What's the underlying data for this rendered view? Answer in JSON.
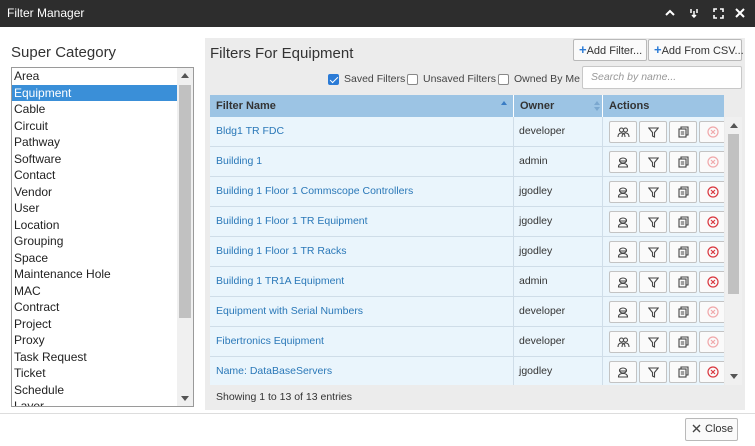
{
  "window": {
    "title": "Filter Manager",
    "controls": [
      "chevron-up-icon",
      "minimize-icon",
      "maximize-icon",
      "close-icon"
    ]
  },
  "super_category": {
    "title": "Super Category",
    "selected": "Equipment",
    "items": [
      "Area",
      "Equipment",
      "Cable",
      "Circuit",
      "Pathway",
      "Software",
      "Contact",
      "Vendor",
      "User",
      "Location",
      "Grouping",
      "Space",
      "Maintenance Hole",
      "MAC",
      "Contract",
      "Project",
      "Proxy",
      "Task Request",
      "Ticket",
      "Schedule",
      "Layer"
    ]
  },
  "filters": {
    "title": "Filters For Equipment",
    "add_filter_label": "Add Filter...",
    "add_csv_label": "Add From CSV...",
    "checkboxes": [
      {
        "label": "Saved Filters",
        "checked": true
      },
      {
        "label": "Unsaved Filters",
        "checked": false
      },
      {
        "label": "Owned By Me",
        "checked": false
      }
    ],
    "search_placeholder": "Search by name...",
    "columns": {
      "name": "Filter Name",
      "owner": "Owner",
      "actions": "Actions"
    },
    "rows": [
      {
        "name": "Bldg1 TR FDC",
        "owner": "developer",
        "delete_enabled": false,
        "share_icon": "users-icon"
      },
      {
        "name": "Building 1",
        "owner": "admin",
        "delete_enabled": false,
        "share_icon": "user-icon"
      },
      {
        "name": "Building 1 Floor 1 Commscope Controllers",
        "owner": "jgodley",
        "delete_enabled": true,
        "share_icon": "user-icon"
      },
      {
        "name": "Building 1 Floor 1 TR Equipment",
        "owner": "jgodley",
        "delete_enabled": true,
        "share_icon": "user-icon"
      },
      {
        "name": "Building 1 Floor 1 TR Racks",
        "owner": "jgodley",
        "delete_enabled": true,
        "share_icon": "user-icon"
      },
      {
        "name": "Building 1 TR1A Equipment",
        "owner": "admin",
        "delete_enabled": true,
        "share_icon": "user-icon"
      },
      {
        "name": "Equipment with Serial Numbers",
        "owner": "developer",
        "delete_enabled": false,
        "share_icon": "user-icon"
      },
      {
        "name": "Fibertronics Equipment",
        "owner": "developer",
        "delete_enabled": false,
        "share_icon": "users-icon"
      },
      {
        "name": "Name: DataBaseServers",
        "owner": "jgodley",
        "delete_enabled": true,
        "share_icon": "user-icon"
      }
    ],
    "footer": "Showing 1 to 13 of 13 entries"
  },
  "close_label": "Close",
  "colors": {
    "titlebar": "#2d2d2d",
    "selected_item": "#3a8fd8",
    "table_header": "#9cc4e4",
    "row_bg": "#eaf5fc",
    "link": "#2a78b8",
    "delete_active": "#d9363e",
    "delete_inactive": "#f0a8aa"
  }
}
